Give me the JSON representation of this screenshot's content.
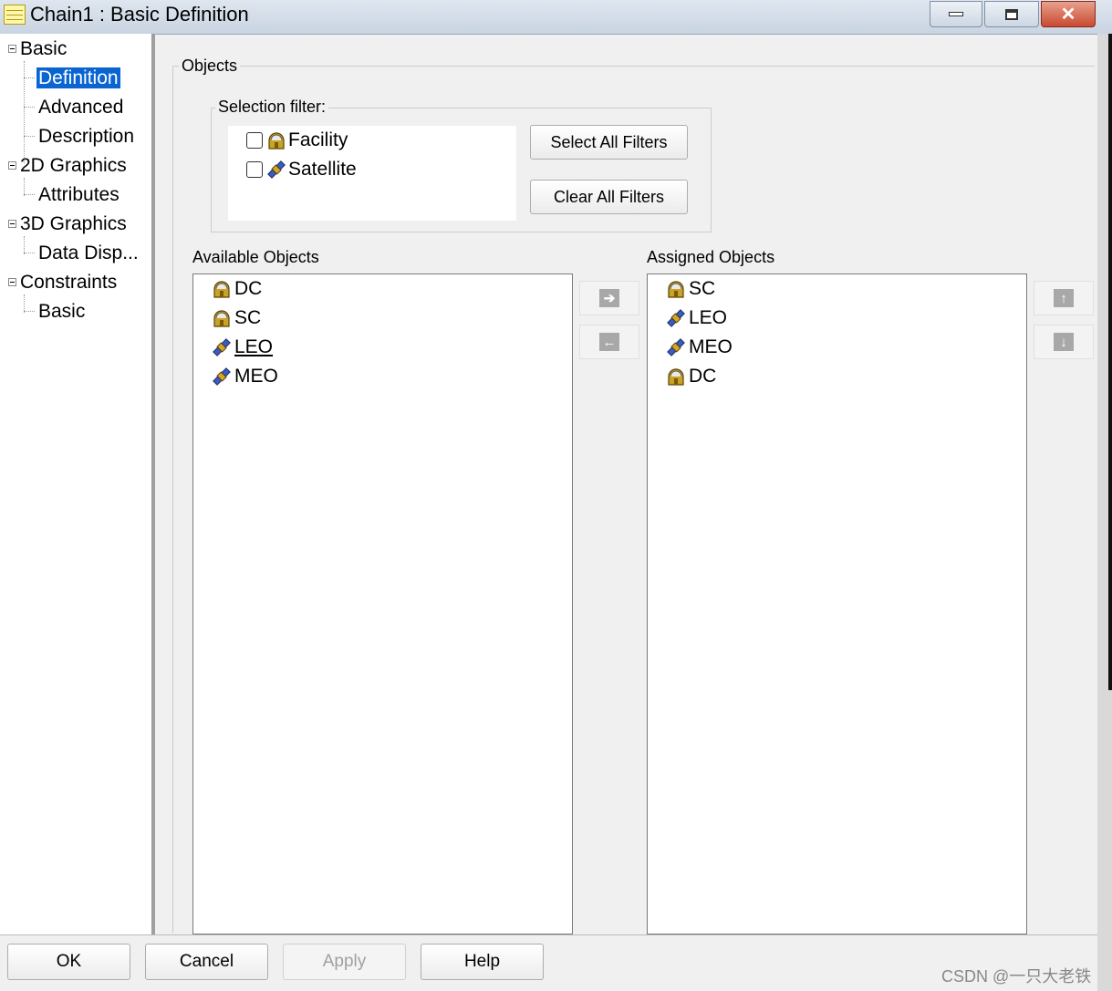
{
  "window": {
    "title": "Chain1 : Basic Definition",
    "close_glyph": "✕"
  },
  "tree": {
    "nodes": [
      {
        "label": "Basic"
      },
      {
        "label": "Definition"
      },
      {
        "label": "Advanced"
      },
      {
        "label": "Description"
      },
      {
        "label": "2D Graphics"
      },
      {
        "label": "Attributes"
      },
      {
        "label": "3D Graphics"
      },
      {
        "label": "Data Disp..."
      },
      {
        "label": "Constraints"
      },
      {
        "label": "Basic"
      }
    ]
  },
  "objects": {
    "group_label": "Objects",
    "filter": {
      "label": "Selection filter:",
      "items": [
        {
          "label": "Facility",
          "icon": "facility-icon",
          "checked": false
        },
        {
          "label": "Satellite",
          "icon": "satellite-icon",
          "checked": false
        }
      ],
      "select_all_label": "Select All Filters",
      "clear_all_label": "Clear All Filters"
    },
    "available": {
      "label": "Available Objects",
      "items": [
        {
          "label": "DC",
          "icon": "facility-icon"
        },
        {
          "label": "SC",
          "icon": "facility-icon"
        },
        {
          "label": "LEO",
          "icon": "satellite-icon"
        },
        {
          "label": "MEO",
          "icon": "satellite-icon"
        }
      ]
    },
    "assigned": {
      "label": "Assigned Objects",
      "items": [
        {
          "label": "SC",
          "icon": "facility-icon"
        },
        {
          "label": "LEO",
          "icon": "satellite-icon"
        },
        {
          "label": "MEO",
          "icon": "satellite-icon"
        },
        {
          "label": "DC",
          "icon": "facility-icon"
        }
      ]
    },
    "arrows": {
      "right": "➔",
      "left": "←",
      "up": "↑",
      "down": "↓"
    }
  },
  "buttons": {
    "ok": "OK",
    "cancel": "Cancel",
    "apply": "Apply",
    "help": "Help"
  },
  "watermark": "CSDN @一只大老铁"
}
